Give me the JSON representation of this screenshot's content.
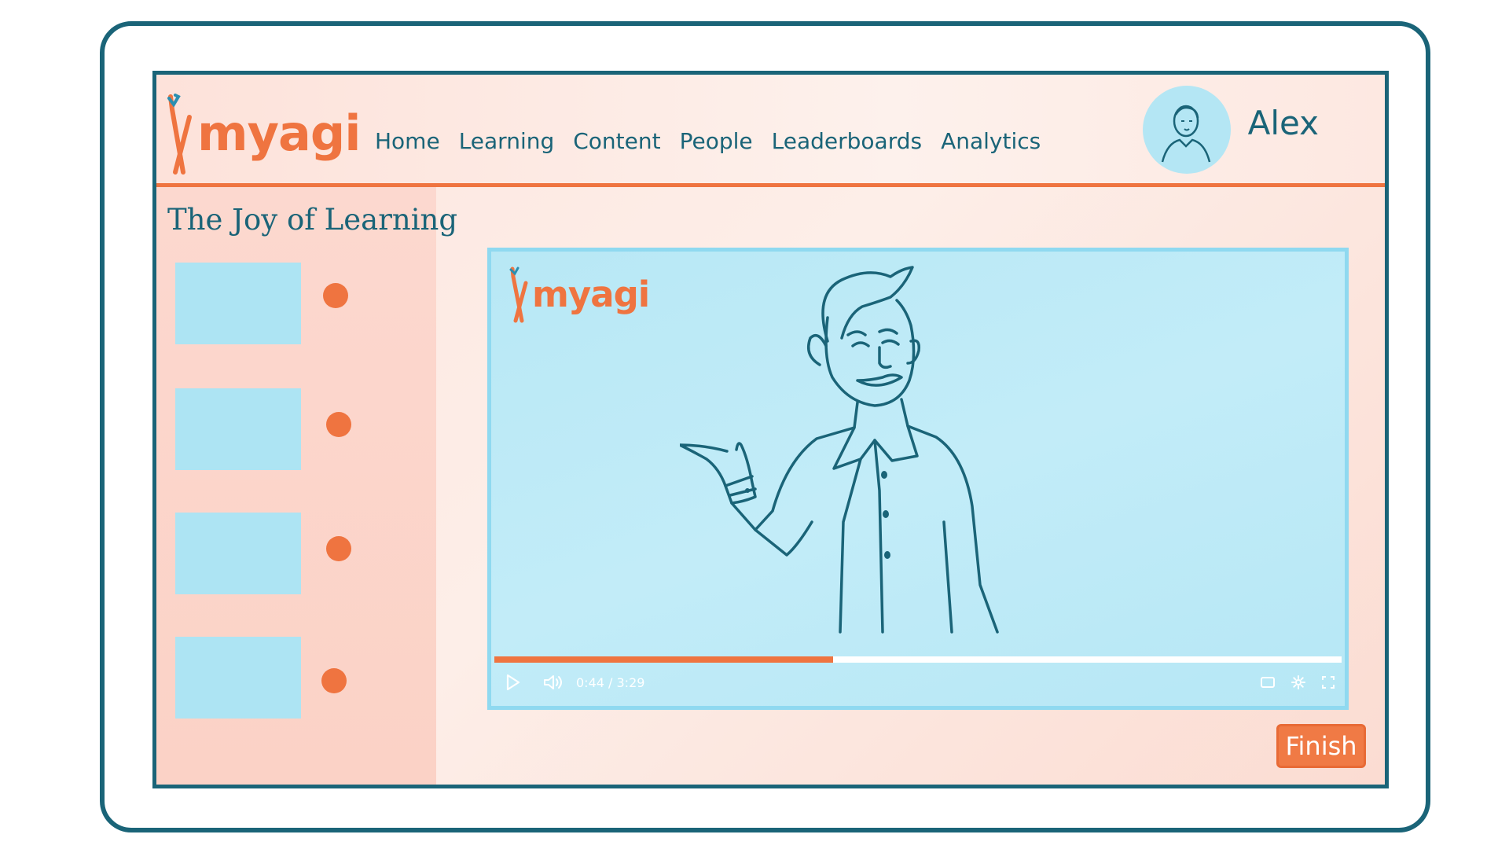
{
  "app": {
    "brand": "myagi"
  },
  "nav": {
    "items": [
      {
        "label": "Home"
      },
      {
        "label": "Learning"
      },
      {
        "label": "Content"
      },
      {
        "label": "People"
      },
      {
        "label": "Leaderboards"
      },
      {
        "label": "Analytics"
      }
    ]
  },
  "user": {
    "name": "Alex",
    "avatar_icon": "person-portrait-icon"
  },
  "sidebar": {
    "course_title": "The Joy of Learning",
    "lessons": [
      {
        "status_icon": "status-dot-icon"
      },
      {
        "status_icon": "status-dot-icon"
      },
      {
        "status_icon": "status-dot-icon"
      },
      {
        "status_icon": "status-dot-icon"
      }
    ]
  },
  "player": {
    "watermark": "myagi",
    "time": "0:44 / 3:29",
    "progress": 0.4,
    "icons": [
      "play-icon",
      "volume-icon",
      "subtitles-icon",
      "settings-icon",
      "fullscreen-icon"
    ]
  },
  "actions": {
    "finish_label": "Finish"
  },
  "colors": {
    "accent": "#ef7440",
    "ink": "#1a6478",
    "video_bg": "#bde9f6",
    "screen_bg": "#fde6df"
  }
}
